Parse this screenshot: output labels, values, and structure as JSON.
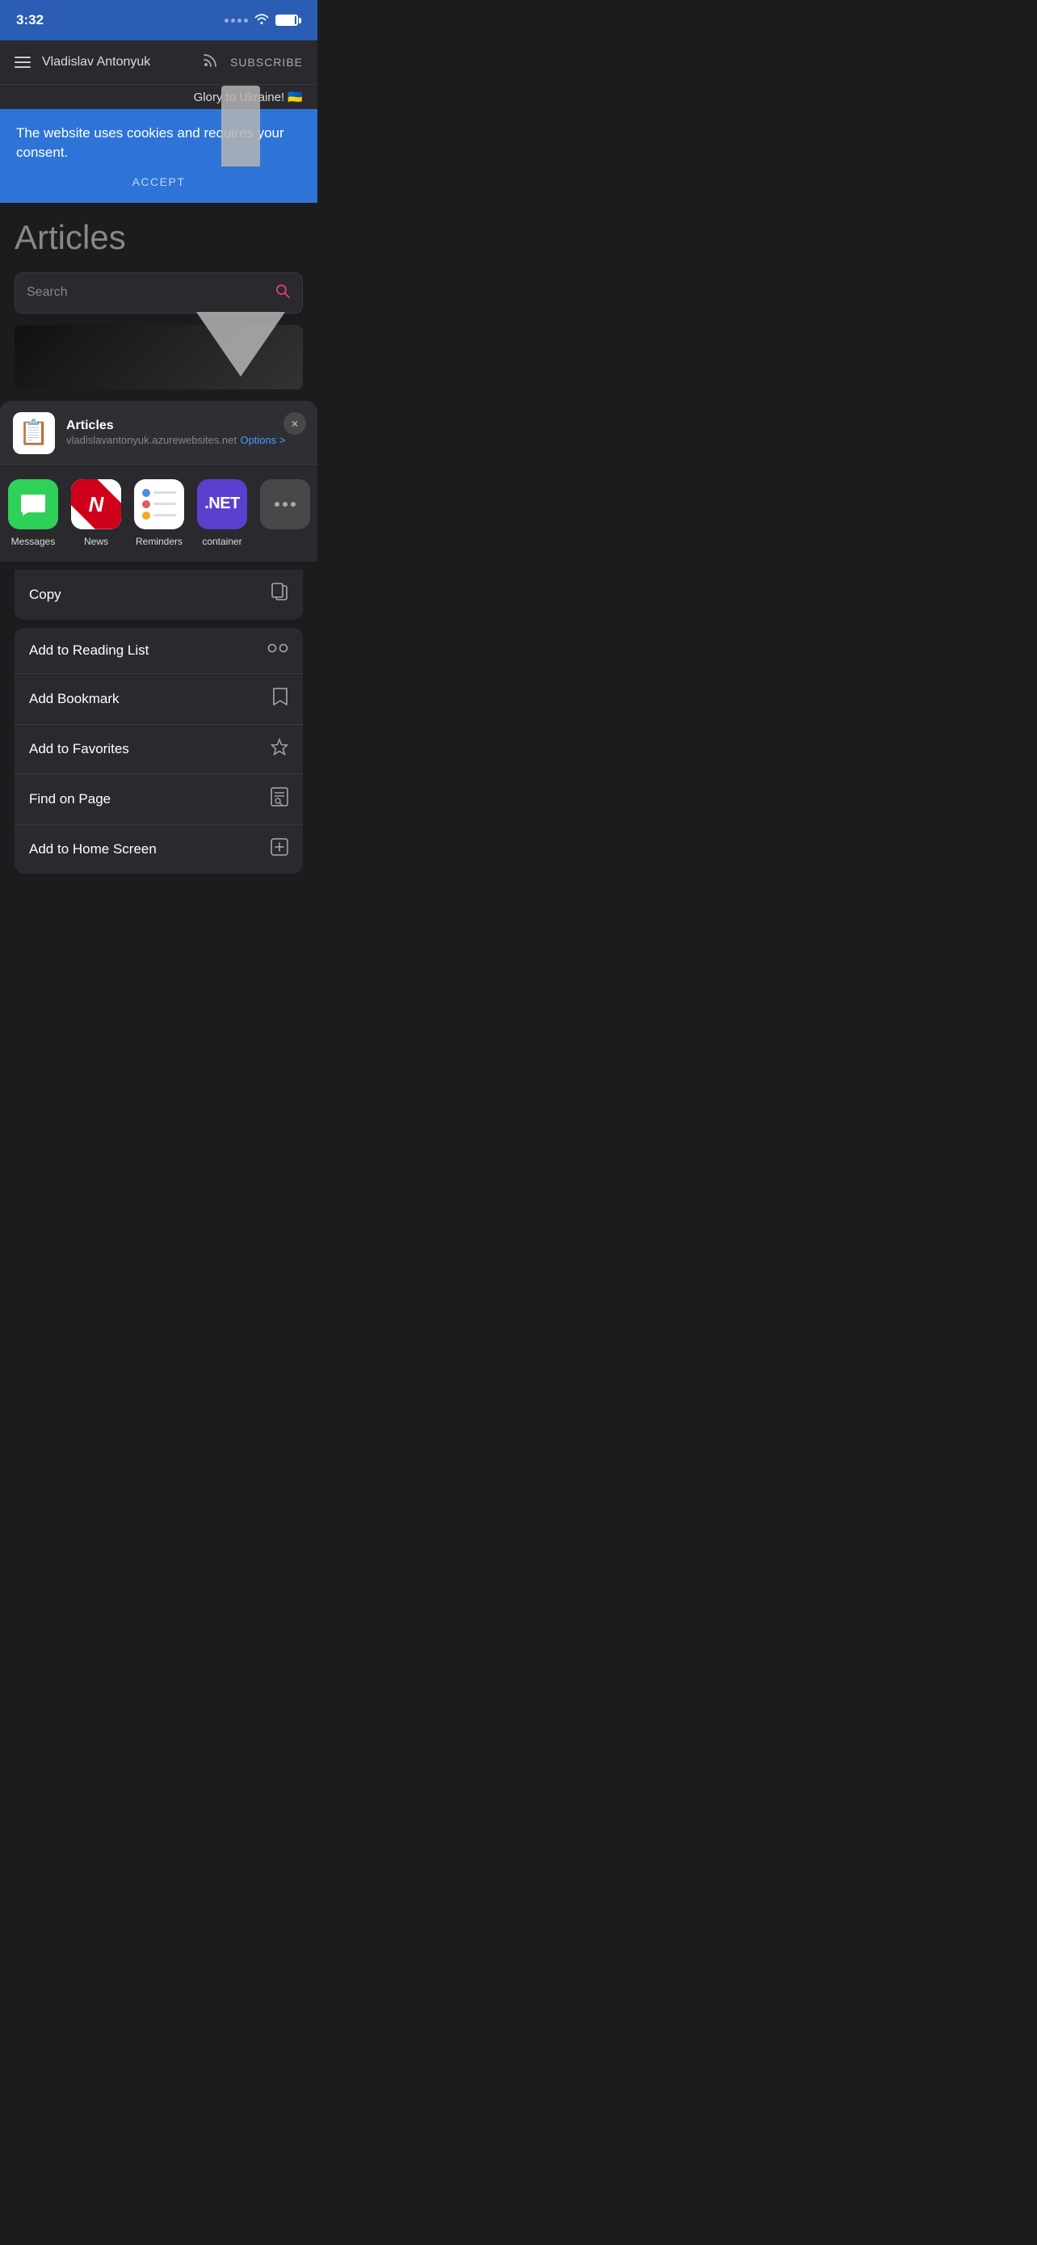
{
  "statusBar": {
    "time": "3:32",
    "batteryLevel": 90
  },
  "navBar": {
    "menuIcon": "≡",
    "title": "Vladislav Antonyuk",
    "rssIcon": "rss",
    "subscribeLabel": "SUBSCRIBE"
  },
  "ukraineBanner": {
    "text": "Glory to Ukraine! 🇺🇦"
  },
  "cookieBanner": {
    "text": "The website uses cookies and requires your consent.",
    "acceptLabel": "ACCEPT"
  },
  "articlesSection": {
    "title": "Articles",
    "searchPlaceholder": "Search"
  },
  "shareSheet": {
    "appName": "Articles",
    "url": "vladislavantonyuk.azurewebsites.net",
    "optionsLabel": "Options >",
    "closeLabel": "×",
    "apps": [
      {
        "id": "messages",
        "label": "Messages"
      },
      {
        "id": "news",
        "label": "News"
      },
      {
        "id": "reminders",
        "label": "Reminders"
      },
      {
        "id": "container",
        "label": "container"
      },
      {
        "id": "more",
        "label": ""
      }
    ],
    "actions": {
      "copy": {
        "label": "Copy",
        "icon": "copy"
      },
      "items": [
        {
          "label": "Add to Reading List",
          "icon": "glasses"
        },
        {
          "label": "Add Bookmark",
          "icon": "book"
        },
        {
          "label": "Add to Favorites",
          "icon": "star"
        },
        {
          "label": "Find on Page",
          "icon": "search-doc"
        },
        {
          "label": "Add to Home Screen",
          "icon": "plus-square"
        }
      ]
    }
  }
}
